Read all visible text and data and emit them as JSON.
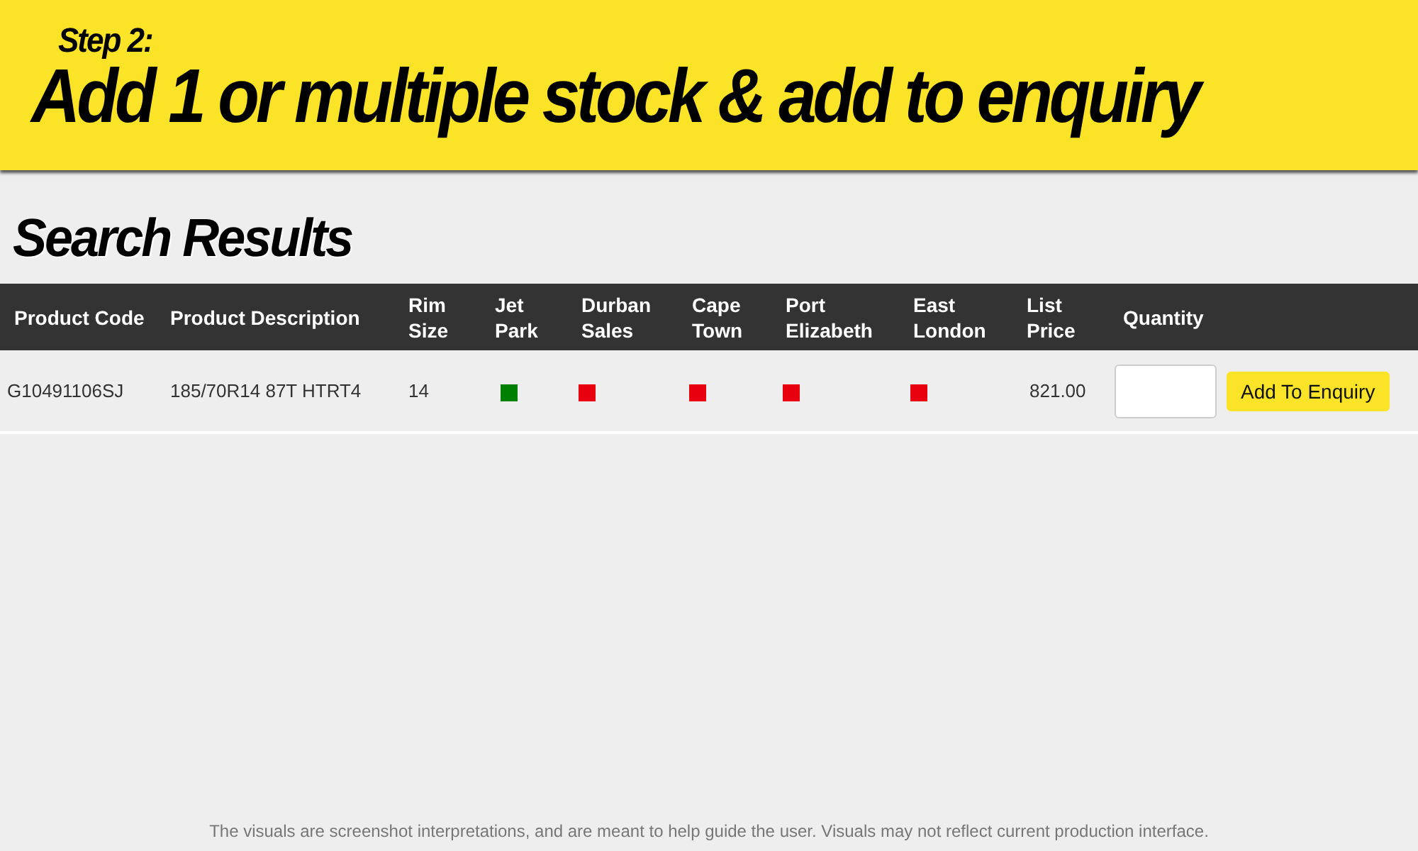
{
  "banner": {
    "step": "Step 2:",
    "title": "Add 1 or multiple stock & add to enquiry"
  },
  "heading": "Search Results",
  "table": {
    "columns": [
      "Product Code",
      "Product Description",
      "Rim Size",
      "Jet Park",
      "Durban Sales",
      "Cape Town",
      "Port Elizabeth",
      "East London",
      "List Price",
      "Quantity"
    ],
    "rows": [
      {
        "product_code": "G10491106SJ",
        "description": "185/70R14 87T HTRT4",
        "rim_size": "14",
        "stock": [
          {
            "color": "#008000"
          },
          {
            "color": "#e8000e"
          },
          {
            "color": "#e8000e"
          },
          {
            "color": "#e8000e"
          },
          {
            "color": "#e8000e"
          }
        ],
        "list_price": "821.00",
        "button": "Add To Enquiry"
      }
    ]
  },
  "footer": "The visuals are screenshot interpretations, and are meant to help guide the user. Visuals may not reflect current production interface."
}
